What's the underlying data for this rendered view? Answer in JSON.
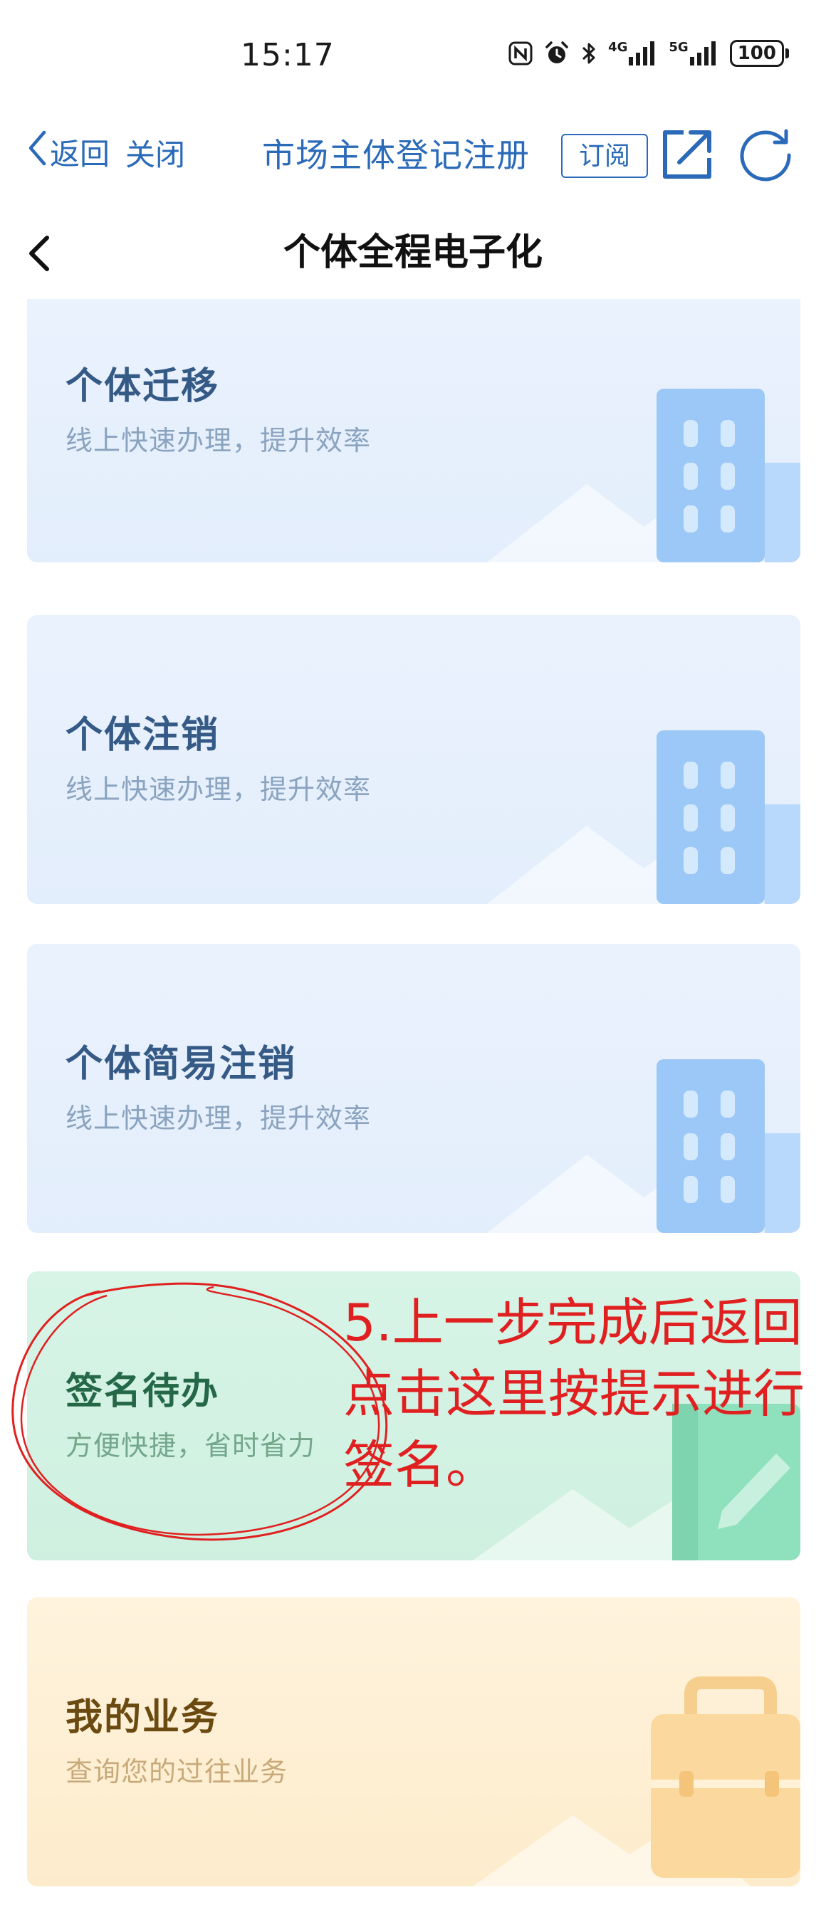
{
  "status_bar": {
    "time": "15:17",
    "signal_1_label": "4G",
    "signal_2_label": "5G",
    "battery": "100"
  },
  "app_bar": {
    "back_label": "返回",
    "close_label": "关闭",
    "title": "市场主体登记注册",
    "subscribe_label": "订阅"
  },
  "page": {
    "title": "个体全程电子化"
  },
  "cards": [
    {
      "title": "个体迁移",
      "subtitle": "线上快速办理，提升效率",
      "icon": "building-icon"
    },
    {
      "title": "个体注销",
      "subtitle": "线上快速办理，提升效率",
      "icon": "building-icon"
    },
    {
      "title": "个体简易注销",
      "subtitle": "线上快速办理，提升效率",
      "icon": "building-icon"
    },
    {
      "title": "签名待办",
      "subtitle": "方便快捷，省时省力",
      "icon": "pen-notebook-icon"
    },
    {
      "title": "我的业务",
      "subtitle": "查询您的过往业务",
      "icon": "briefcase-icon"
    }
  ],
  "annotation": {
    "lines": [
      "5.上一步完成后返回",
      "点击这里按提示进行",
      "签名。"
    ]
  },
  "colors": {
    "accent": "#2a6ab8",
    "annotation_red": "#e02020",
    "card_blue": "#e6f0fc",
    "card_green": "#d3f2e3",
    "card_orange": "#feefd3"
  }
}
